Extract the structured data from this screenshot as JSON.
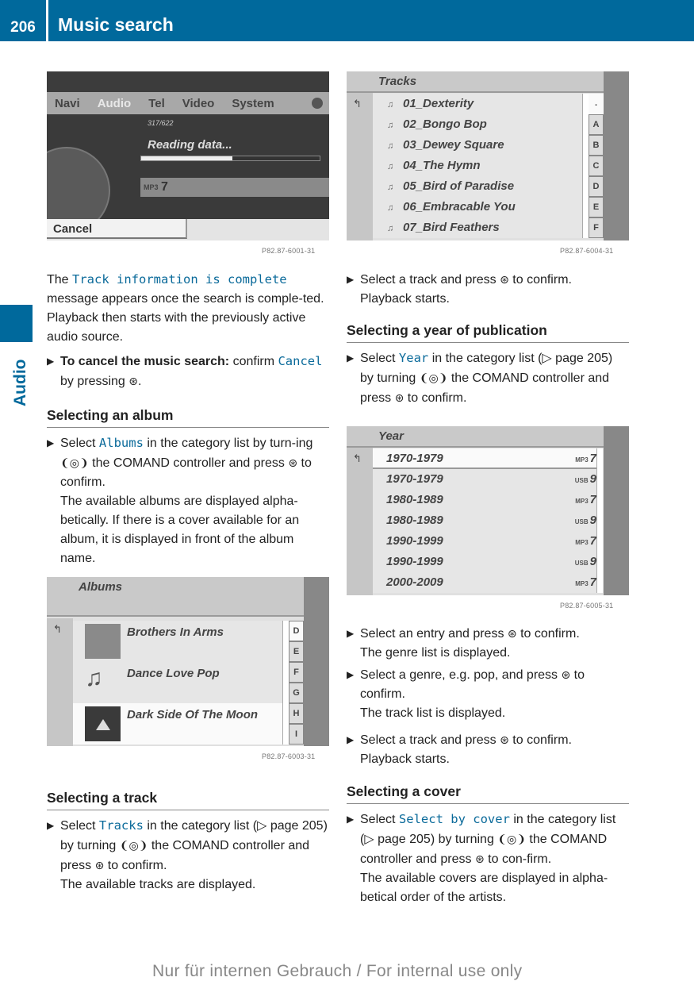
{
  "header": {
    "page_number": "206",
    "title": "Music search"
  },
  "side_tab": {
    "label": "Audio"
  },
  "screen_cancel": {
    "menu": [
      "Navi",
      "Audio",
      "Tel",
      "Video",
      "System"
    ],
    "active_menu": "Audio",
    "count": "317/622",
    "status": "Reading data...",
    "progress_fraction": 0.51,
    "source_number": "7",
    "cancel_label": "Cancel",
    "code": "P82.87-6001-31"
  },
  "screen_tracks": {
    "header": "Tracks",
    "rows": [
      "01_Dexterity",
      "02_Bongo Bop",
      "03_Dewey Square",
      "04_The Hymn",
      "05_Bird of Paradise",
      "06_Embracable You",
      "07_Bird Feathers"
    ],
    "alpha": [
      ".",
      "A",
      "B",
      "C",
      "D",
      "E",
      "F"
    ],
    "code": "P82.87-6004-31"
  },
  "screen_albums": {
    "header": "Albums",
    "rows": [
      "Brothers In Arms",
      "Dance Love Pop",
      "Dark Side Of The Moon"
    ],
    "alpha": [
      "D",
      "E",
      "F",
      "G",
      "H",
      "I"
    ],
    "code": "P82.87-6003-31"
  },
  "screen_year": {
    "header": "Year",
    "rows": [
      {
        "range": "1970-1979",
        "source": "MP3",
        "num": "7"
      },
      {
        "range": "1970-1979",
        "source": "USB",
        "num": "9"
      },
      {
        "range": "1980-1989",
        "source": "MP3",
        "num": "7"
      },
      {
        "range": "1980-1989",
        "source": "USB",
        "num": "9"
      },
      {
        "range": "1990-1999",
        "source": "MP3",
        "num": "7"
      },
      {
        "range": "1990-1999",
        "source": "USB",
        "num": "9"
      },
      {
        "range": "2000-2009",
        "source": "MP3",
        "num": "7"
      }
    ],
    "code": "P82.87-6005-31"
  },
  "text": {
    "p1_pre": "The ",
    "p1_code": "Track information is complete",
    "p1_post": " message appears once the search is comple-ted. Playback then starts with the previously active audio source.",
    "cancel_bold": "To cancel the music search:",
    "cancel_post1": " confirm ",
    "cancel_code": "Cancel",
    "cancel_post2": " by pressing ",
    "press_icon": "⊛",
    "turn_icon": "❨◎❩",
    "h_album": "Selecting an album",
    "album_pre": "Select ",
    "album_code": "Albums",
    "album_mid": " in the category list by turn-ing ",
    "album_post": " the COMAND controller and press ",
    "album_end": " to confirm.",
    "album_desc": "The available albums are displayed alpha-betically. If there is a cover available for an album, it is displayed in front of the album name.",
    "h_track": "Selecting a track",
    "track_pre": "Select ",
    "track_code": "Tracks",
    "track_mid": " in the category list (▷ page 205) by turning ",
    "track_post": " the COMAND controller and press ",
    "track_end": " to confirm.",
    "track_desc": "The available tracks are displayed.",
    "select_track_1": "Select a track and press ",
    "select_track_2": " to confirm.",
    "playback": "Playback starts.",
    "h_year": "Selecting a year of publication",
    "year_pre": "Select ",
    "year_code": "Year",
    "year_mid": " in the category list (▷ page 205) by turning ",
    "year_post": " the COMAND controller and press ",
    "year_end": " to confirm.",
    "entry_1": "Select an entry and press ",
    "entry_2": " to confirm.",
    "entry_desc": "The genre list is displayed.",
    "genre_1": "Select a genre, e.g. pop, and press ",
    "genre_2": " to confirm.",
    "genre_desc": "The track list is displayed.",
    "h_cover": "Selecting a cover",
    "cover_pre": "Select ",
    "cover_code": "Select by cover",
    "cover_mid": " in the category list (▷ page 205) by turning ",
    "cover_post": " the COMAND controller and press ",
    "cover_end": " to con-firm.",
    "cover_desc": "The available covers are displayed in alpha-betical order of the artists."
  },
  "watermark": "Nur für internen Gebrauch / For internal use only"
}
